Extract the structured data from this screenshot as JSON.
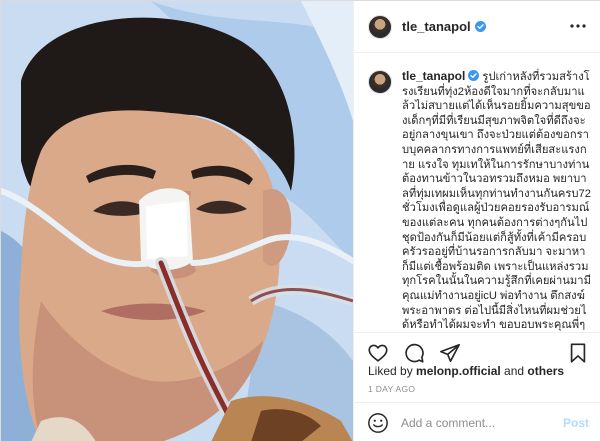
{
  "post": {
    "username": "tle_tanapol",
    "caption": "รูปเก่าหลังที่รวมสร้างโรงเรียนที่ทุ่ง2ห้องดีใจมากที่จะกลับมาแล้วไม่สบายแต่ได้เห็นรอยยิ้มความสุขของเด็กๆที่มีที่เรียนมีสุขภาพจิตใจที่ดีถึงจะอยู่กลางขุนเขา ถึงจะป่วยแต่ต้องขอกราบบุคคลากรทางการแพทย์ที่เสียสะแรงกาย แรงใจ ทุมเทให้ในการรักษาบางท่านต้องทานข้าวในวอทรวมถึงหมอ พยาบาลที่ทุ่มเทผมเห็นทุกท่านทำงานกันครบ72ชั่วโมงเพื่อดูแลผู้ป่วยคอยรองรับอารมณ์ของแต่ละคน ทุกคนต้องการต่างๆกันไปชุดป้องกันก็มีน้อยแต่ก็สู้ทั้งที่เค้ามีครอบครัวรออยู่ที่บ้านรอการกลับมา จะมาหาก็มีแต่เชื้อพร้อมติด เพราะเป็นแหล่งรวมทุกโรคในนั้นในความรู้สึกที่เคยผ่านมามีคุณแม่ทำงานอยู่icU พ่อทำงาน ตึกสงฆ์ พระอาพาตร ต่อไปนี้มีสิ่งไหนที่ผมช่วยได้หรือทำได้ผมจะทำ ขอบอบพระคุณพี่ๆทุกท่าน กราบจริงในการเสียสะทุกอย่างขอบพระคุณครับ รพ สิงห์บุรี",
    "likes_prefix": "Liked by ",
    "liked_by": "melonp.official",
    "likes_joiner": " and ",
    "likes_others": "others",
    "time_ago": "1 DAY AGO"
  },
  "comment_box": {
    "placeholder": "Add a comment...",
    "post_label": "Post"
  },
  "icons": {
    "verified": "verified-badge-icon",
    "more": "more-options-icon",
    "like": "heart-icon",
    "comment": "comment-icon",
    "share": "share-icon",
    "save": "bookmark-icon",
    "emoji": "emoji-icon"
  },
  "colors": {
    "verified": "#3897f0",
    "post_disabled": "#b3dbff",
    "muted": "#8e8e8e",
    "border": "#efefef"
  }
}
